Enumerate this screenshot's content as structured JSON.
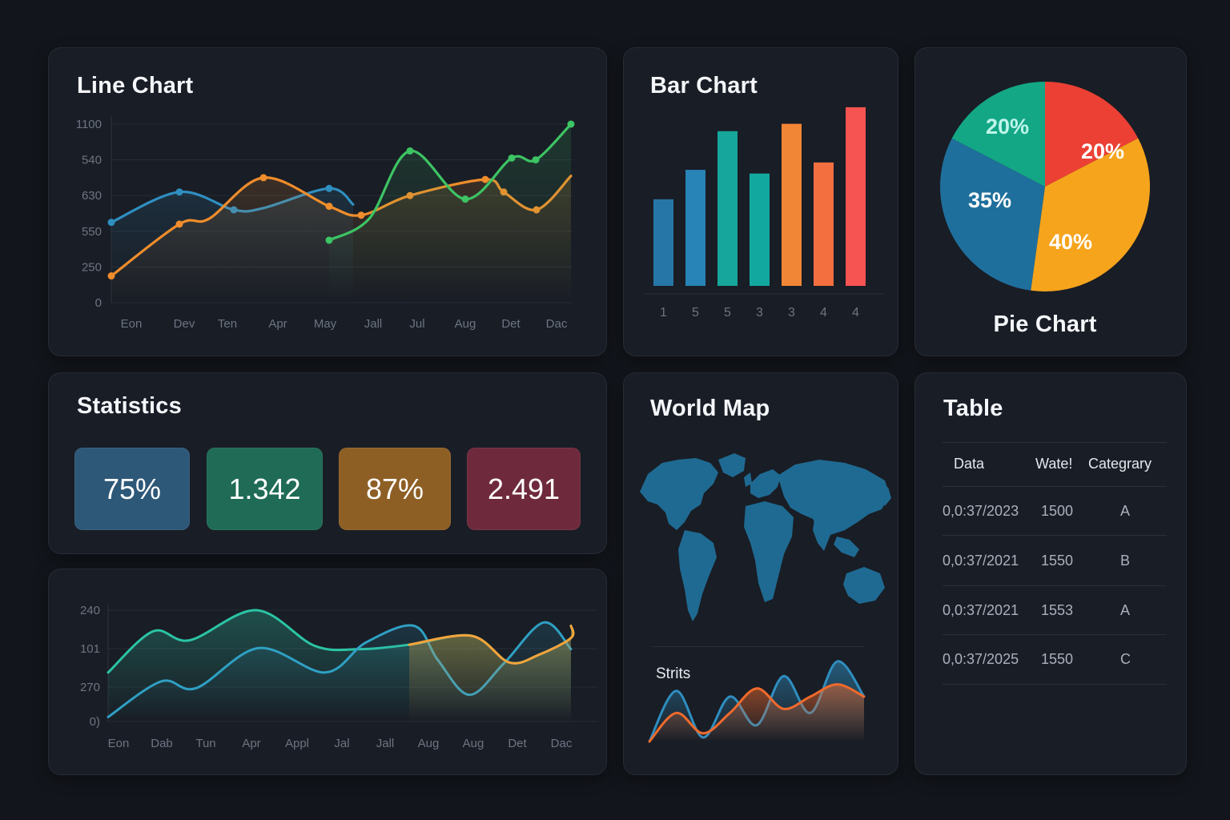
{
  "panels": {
    "line_chart_title": "Line Chart",
    "bar_chart_title": "Bar Chart",
    "pie_chart_title": "Pie Chart",
    "statistics_title": "Statistics",
    "world_map_title": "World Map",
    "table_title": "Table"
  },
  "statistics": {
    "cards": [
      {
        "value": "75%",
        "color": "#2e5878"
      },
      {
        "value": "1.342",
        "color": "#1f6b56"
      },
      {
        "value": "87%",
        "color": "#8e5f25"
      },
      {
        "value": "2.491",
        "color": "#6e2a3c"
      }
    ]
  },
  "map": {
    "sub_label": "Strits"
  },
  "table": {
    "headers": [
      "Data",
      "Wate!",
      "Categrary"
    ],
    "rows": [
      [
        "0,0:37/2023",
        "1500",
        "A"
      ],
      [
        "0,0:37/2021",
        "1550",
        "B"
      ],
      [
        "0,0:37/2021",
        "1553",
        "A"
      ],
      [
        "0,0:37/2025",
        "1550",
        "C"
      ]
    ]
  },
  "chart_data": [
    {
      "type": "line",
      "title": "Line Chart",
      "y_tick_labels": [
        "1100",
        "540",
        "630",
        "550",
        "250",
        "0"
      ],
      "x_tick_labels": [
        "Eon",
        "Dev",
        "Ten",
        "Apr",
        "May",
        "Jall",
        "Jul",
        "Aug",
        "Det",
        "Dac"
      ],
      "grid": true,
      "series": [
        {
          "color": "#2f8ec0",
          "values": [
            0.45,
            0.62,
            0.52,
            0.53,
            0.64,
            0.55
          ]
        },
        {
          "color": "#f08d2c",
          "values": [
            0.15,
            0.44,
            0.47,
            0.7,
            0.54,
            0.49,
            0.6,
            0.69,
            0.62,
            0.52,
            0.71
          ]
        },
        {
          "color": "#3dc464",
          "values": [
            0.35,
            0.47,
            0.85,
            0.58,
            0.81,
            0.8,
            1.0
          ]
        }
      ]
    },
    {
      "type": "bar",
      "title": "Bar Chart",
      "categories": [
        "1",
        "5",
        "5",
        "3",
        "3",
        "4",
        "4"
      ],
      "values": [
        47,
        63,
        84,
        61,
        88,
        67,
        97
      ],
      "colors": [
        "#2676a8",
        "#2883b6",
        "#16a69b",
        "#12a8a0",
        "#f28637",
        "#f46f40",
        "#f65353"
      ],
      "ylim": [
        0,
        100
      ]
    },
    {
      "type": "pie",
      "title": "Pie Chart",
      "labels": [
        "20%",
        "40%",
        "35%",
        "20%"
      ],
      "values": [
        20,
        40,
        35,
        20
      ],
      "colors": [
        "#ec4034",
        "#f5a41c",
        "#1f6f9c",
        "#14a786"
      ]
    },
    {
      "type": "area",
      "y_tick_labels": [
        "240",
        "101",
        "270",
        "0)"
      ],
      "x_tick_labels": [
        "Eon",
        "Dab",
        "Tun",
        "Apr",
        "Appl",
        "Jal",
        "Jall",
        "Aug",
        "Aug",
        "Det",
        "Dac"
      ],
      "series": [
        {
          "color": "#2bc4a4",
          "values": [
            0.44,
            0.81,
            0.73,
            1.0,
            0.68,
            0.65,
            0.69,
            0.77,
            0.53,
            0.6,
            0.75,
            0.86
          ]
        },
        {
          "color": "#2fa0c4",
          "values": [
            0.04,
            0.36,
            0.3,
            0.66,
            0.44,
            0.71,
            0.86,
            0.55,
            0.24,
            0.52,
            0.89,
            0.65
          ]
        }
      ]
    },
    {
      "type": "area",
      "title": "",
      "series": [
        {
          "color": "#2f8ec0",
          "values": [
            0,
            0.62,
            0.05,
            0.55,
            0.2,
            0.8,
            0.35,
            0.98,
            0.55
          ]
        },
        {
          "color": "#f06a2c",
          "values": [
            0,
            0.35,
            0.1,
            0.35,
            0.65,
            0.4,
            0.55,
            0.7,
            0.55
          ]
        }
      ]
    }
  ]
}
